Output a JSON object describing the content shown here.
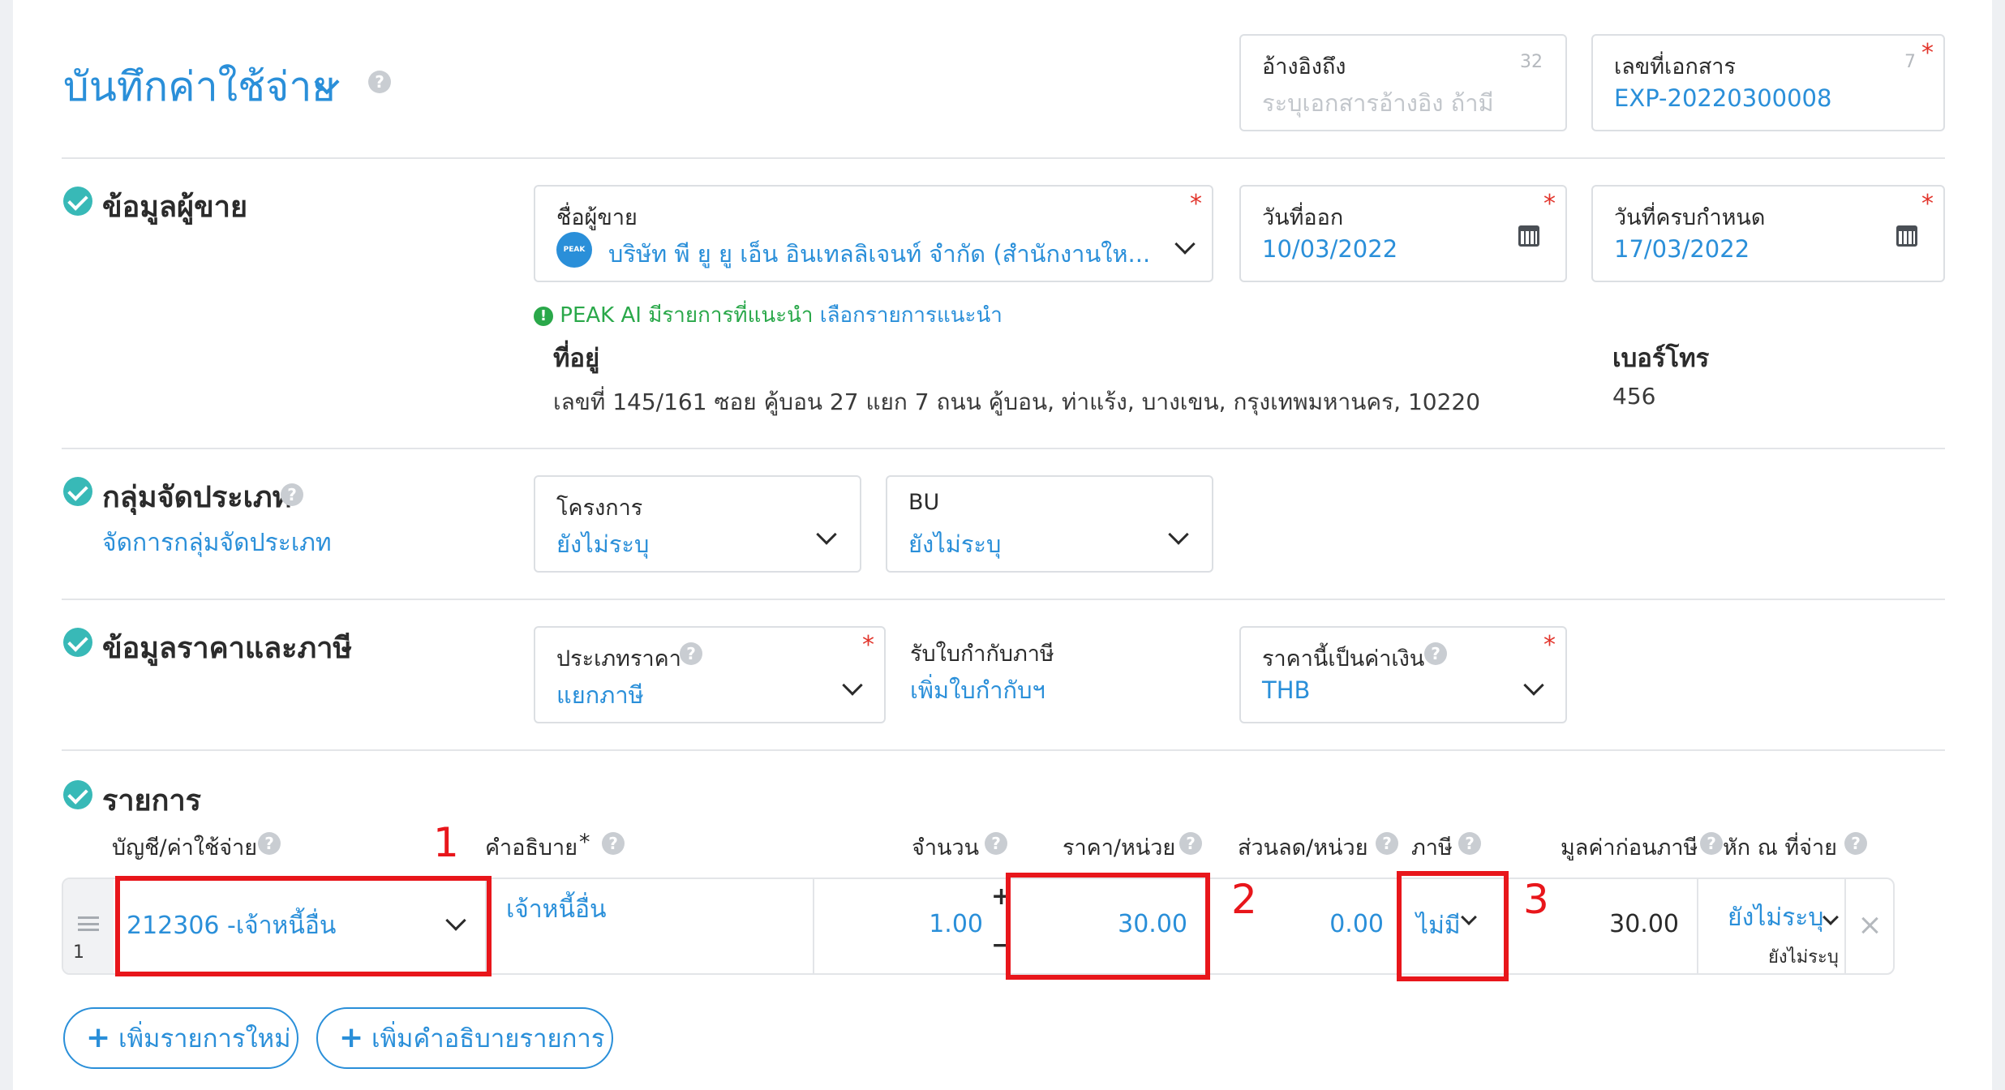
{
  "header": {
    "title": "บันทึกค่าใช้จ่าย",
    "reference": {
      "label": "อ้างอิงถึง",
      "count": "32",
      "placeholder": "ระบุเอกสารอ้างอิง ถ้ามี"
    },
    "doc_number": {
      "label": "เลขที่เอกสาร",
      "count": "7",
      "required": "*",
      "value": "EXP-20220300008"
    }
  },
  "vendor_section": {
    "title": "ข้อมูลผู้ขาย",
    "vendor": {
      "label": "ชื่อผู้ขาย",
      "required": "*",
      "logo_text": "PEAK",
      "value": "บริษัท พี ยู ยู เอ็น อินเทลลิเจนท์ จำกัด (สำนักงานให..."
    },
    "issue_date": {
      "label": "วันที่ออก",
      "required": "*",
      "value": "10/03/2022"
    },
    "due_date": {
      "label": "วันที่ครบกำหนด",
      "required": "*",
      "value": "17/03/2022"
    },
    "ai_hint": {
      "icon": "!",
      "text": "PEAK AI มีรายการที่แนะนำ",
      "link": "เลือกรายการแนะนำ"
    },
    "address": {
      "label": "ที่อยู่",
      "value": "เลขที่ 145/161 ซอย คู้บอน 27 แยก 7 ถนน คู้บอน, ท่าแร้ง, บางเขน, กรุงเทพมหานคร, 10220"
    },
    "phone": {
      "label": "เบอร์โทร",
      "value": "456"
    }
  },
  "group_section": {
    "title": "กลุ่มจัดประเภท",
    "manage_link": "จัดการกลุ่มจัดประเภท",
    "project": {
      "label": "โครงการ",
      "value": "ยังไม่ระบุ"
    },
    "bu": {
      "label": "BU",
      "value": "ยังไม่ระบุ"
    }
  },
  "price_section": {
    "title": "ข้อมูลราคาและภาษี",
    "price_type": {
      "label": "ประเภทราคา",
      "required": "*",
      "value": "แยกภาษี"
    },
    "tax_invoice": {
      "label": "รับใบกำกับภาษี",
      "link": "เพิ่มใบกำกับฯ"
    },
    "currency": {
      "label": "ราคานี้เป็นค่าเงิน",
      "required": "*",
      "value": "THB"
    }
  },
  "items_section": {
    "title": "รายการ",
    "columns": {
      "account": "บัญชี/ค่าใช้จ่าย",
      "description": "คำอธิบาย",
      "description_required": "*",
      "qty": "จำนวน",
      "price": "ราคา/หน่วย",
      "discount": "ส่วนลด/หน่วย",
      "tax": "ภาษี",
      "pretax": "มูลค่าก่อนภาษี",
      "withholding": "หัก ณ ที่จ่าย"
    },
    "rows": [
      {
        "index": "1",
        "account": "212306 -เจ้าหนี้อื่น",
        "description": "เจ้าหนี้อื่น",
        "qty": "1.00",
        "price": "30.00",
        "discount": "0.00",
        "tax": "ไม่มี",
        "pretax": "30.00",
        "withholding": "ยังไม่ระบุ",
        "withholding_sub": "ยังไม่ระบุ"
      }
    ],
    "add_item_button": "เพิ่มรายการใหม่",
    "add_description_button": "เพิ่มคำอธิบายรายการ"
  },
  "annotations": [
    "1",
    "2",
    "3"
  ],
  "stepper": {
    "plus": "+",
    "minus": "−"
  },
  "colors": {
    "accent": "#2a8fd9",
    "check": "#38b9b7",
    "annotation": "#e8161b",
    "ai_hint": "#2aa84a"
  }
}
